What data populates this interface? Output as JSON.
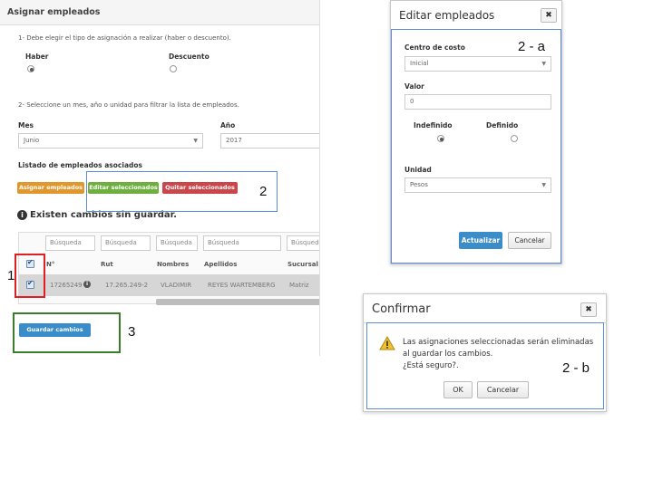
{
  "main": {
    "title": "Asignar empleados",
    "step1_text": "1- Debe elegir el tipo de asignación a realizar (haber o descuento).",
    "haber_label": "Haber",
    "descuento_label": "Descuento",
    "selected_type": "Haber",
    "step2_text": "2- Seleccione un mes, año o unidad para filtrar la lista de empleados.",
    "mes_label": "Mes",
    "mes_value": "Junio",
    "anio_label": "Año",
    "anio_value": "2017",
    "list_title": "Listado de empleados asociados",
    "buttons": {
      "asignar": "Asignar empleados",
      "editar": "Editar seleccionados",
      "quitar": "Quitar seleccionados"
    },
    "unsaved_notice": "Existen cambios sin guardar.",
    "search_placeholder": "Búsqueda",
    "columns": [
      "N°",
      "Rut",
      "Nombres",
      "Apellidos",
      "Sucursal"
    ],
    "rows": [
      {
        "numero": "17265249",
        "rut": "17.265.249-2",
        "nombres": "VLADIMIR",
        "apellidos": "REYES WARTEMBERG",
        "sucursal": "Matriz"
      }
    ],
    "save_button": "Guardar cambios"
  },
  "edit_dialog": {
    "title": "Editar empleados",
    "centro_label": "Centro de costo",
    "centro_value": "Inicial",
    "valor_label": "Valor",
    "valor_value": "0",
    "indefinido_label": "Indefinido",
    "definido_label": "Definido",
    "selected_duration": "Indefinido",
    "unidad_label": "Unidad",
    "unidad_value": "Pesos",
    "update_button": "Actualizar",
    "cancel_button": "Cancelar"
  },
  "confirm_dialog": {
    "title": "Confirmar",
    "message_line1": "Las asignaciones seleccionadas serán eliminadas",
    "message_line2": "al guardar los cambios.",
    "message_line3": "¿Está seguro?.",
    "ok_button": "OK",
    "cancel_button": "Cancelar"
  },
  "annotations": {
    "label_1": "1",
    "label_2": "2",
    "label_2a": "2 - a",
    "label_2b": "2 - b",
    "label_3": "3"
  },
  "colors": {
    "asignar_button": "#e0982e",
    "editar_button": "#6faf3f",
    "quitar_button": "#c9464a",
    "primary_button": "#3a8dc9",
    "box_blue": "#5b8ed6",
    "box_red": "#e02020",
    "box_green": "#3a7d2c",
    "warning_icon": "#f0c030"
  },
  "icons": [
    "info-circle-icon",
    "checkbox-check-icon",
    "close-icon",
    "warning-icon",
    "chevron-down-icon"
  ]
}
